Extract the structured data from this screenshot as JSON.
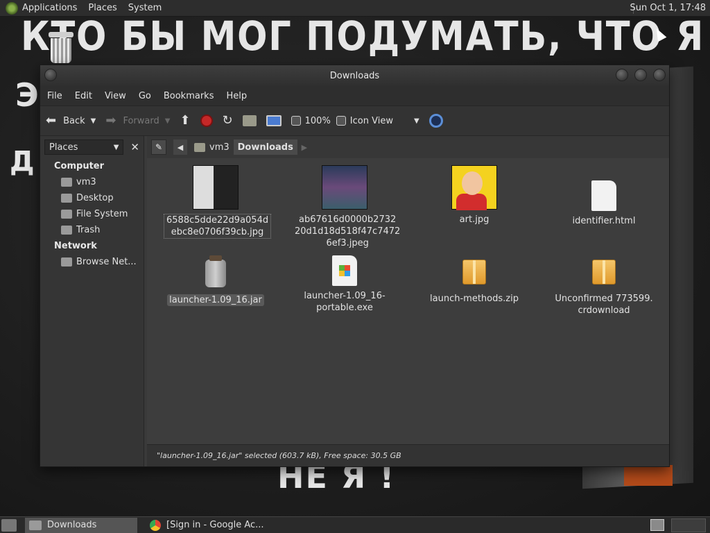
{
  "top_panel": {
    "menus": [
      "Applications",
      "Places",
      "System"
    ],
    "clock": "Sun Oct  1, 17:48"
  },
  "desktop": {
    "chalk_line1": "КТО БЫ МОГ ПОДУМАТЬ, ЧТО Я –",
    "chalk_line2": "Э",
    "chalk_line3": "Д",
    "chalk_bottom": "НЕ Я !"
  },
  "window": {
    "title": "Downloads",
    "menu": [
      "File",
      "Edit",
      "View",
      "Go",
      "Bookmarks",
      "Help"
    ],
    "toolbar": {
      "back": "Back",
      "forward": "Forward",
      "zoom": "100%",
      "view_mode": "Icon View"
    },
    "sidebar": {
      "combo": "Places",
      "sections": [
        {
          "title": "Computer",
          "items": [
            "vm3",
            "Desktop",
            "File System",
            "Trash"
          ]
        },
        {
          "title": "Network",
          "items": [
            "Browse Net..."
          ]
        }
      ]
    },
    "pathbar": {
      "crumbs": [
        "vm3",
        "Downloads"
      ]
    },
    "files": [
      {
        "name": "6588c5dde22d9a054d\nebc8e0706f39cb.jpg",
        "icon": "image-thumbnail"
      },
      {
        "name": "ab67616d0000b2732\n20d1d18d518f47c7472\n6ef3.jpeg",
        "icon": "image-thumbnail"
      },
      {
        "name": "art.jpg",
        "icon": "image-thumbnail"
      },
      {
        "name": "identifier.html",
        "icon": "html-document-icon"
      },
      {
        "name": "launcher-1.09_16.jar",
        "icon": "jar-icon"
      },
      {
        "name": "launcher-1.09_16-\nportable.exe",
        "icon": "exe-icon"
      },
      {
        "name": "launch-methods.zip",
        "icon": "zip-icon"
      },
      {
        "name": "Unconfirmed 773599.\ncrdownload",
        "icon": "package-icon"
      }
    ],
    "status": "\"launcher-1.09_16.jar\" selected (603.7 kB), Free space: 30.5 GB"
  },
  "taskbar": {
    "tasks": [
      "Downloads",
      "[Sign in - Google Ac..."
    ]
  }
}
